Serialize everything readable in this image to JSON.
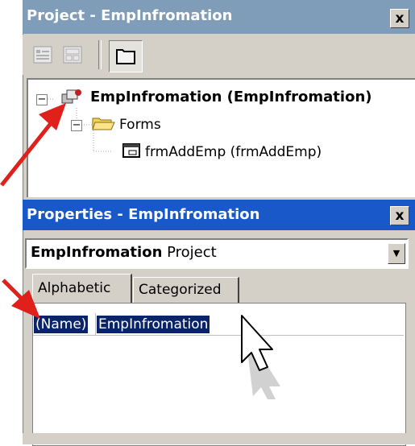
{
  "project_panel": {
    "title": "Project - EmpInfromation",
    "close_label": "x",
    "toolbar": {
      "view_code_icon": "view-code-icon",
      "view_object_icon": "view-object-icon",
      "toggle_folders_icon": "folder-icon"
    },
    "tree": {
      "project_node": "EmpInfromation (EmpInfromation)",
      "forms_folder": "Forms",
      "form_item": "frmAddEmp (frmAddEmp)"
    }
  },
  "properties_panel": {
    "title": "Properties - EmpInfromation",
    "close_label": "x",
    "object_name": "EmpInfromation",
    "object_type": "Project",
    "tabs": [
      "Alphabetic",
      "Categorized"
    ],
    "rows": [
      {
        "name": "(Name)",
        "value": "EmpInfromation"
      }
    ]
  },
  "colors": {
    "project_titlebar": "#7f9db9",
    "properties_titlebar": "#1958c8",
    "selection": "#0a246a",
    "arrow": "#e0201a"
  }
}
